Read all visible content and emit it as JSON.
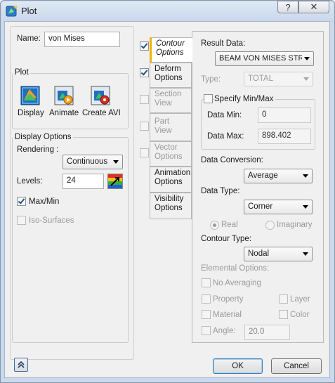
{
  "window": {
    "title": "Plot",
    "help_glyph": "?",
    "close_glyph": "✕"
  },
  "left": {
    "name_label": "Name:",
    "name_value": "von Mises",
    "plot_group": "Plot",
    "display_label": "Display",
    "animate_label": "Animate",
    "avi_label": "Create AVI",
    "display_options_group": "Display Options",
    "rendering_label": "Rendering :",
    "rendering_value": "Continuous",
    "levels_label": "Levels:",
    "levels_value": "24",
    "maxmin_label": "Max/Min",
    "maxmin_checked": true,
    "iso_label": "Iso-Surfaces",
    "iso_checked": false
  },
  "tabs": [
    {
      "line1": "Contour",
      "line2": "Options",
      "checked": true,
      "active": true,
      "disabled": false
    },
    {
      "line1": "Deform",
      "line2": "Options",
      "checked": true,
      "active": false,
      "disabled": false
    },
    {
      "line1": "Section",
      "line2": "View",
      "checked": false,
      "active": false,
      "disabled": true
    },
    {
      "line1": "Part View",
      "line2": "",
      "checked": false,
      "active": false,
      "disabled": true
    },
    {
      "line1": "Vector",
      "line2": "Options",
      "checked": false,
      "active": false,
      "disabled": true
    },
    {
      "line1": "Animation",
      "line2": "Options",
      "active": false,
      "disabled": false
    },
    {
      "line1": "Visibility",
      "line2": "Options",
      "active": false,
      "disabled": false
    }
  ],
  "contour": {
    "result_data_label": "Result Data:",
    "result_data_value": "BEAM VON MISES STRESS",
    "type_label": "Type:",
    "type_value": "TOTAL",
    "specify_minmax_label": "Specify Min/Max",
    "data_min_label": "Data Min:",
    "data_min_value": "0",
    "data_max_label": "Data Max:",
    "data_max_value": "898.402",
    "data_conversion_label": "Data Conversion:",
    "data_conversion_value": "Average",
    "data_type_label": "Data Type:",
    "data_type_value": "Corner",
    "real_label": "Real",
    "imaginary_label": "Imaginary",
    "contour_type_label": "Contour Type:",
    "contour_type_value": "Nodal",
    "elemental_options_label": "Elemental Options:",
    "no_averaging_label": "No Averaging",
    "property_label": "Property",
    "layer_label": "Layer",
    "material_label": "Material",
    "color_label": "Color",
    "angle_label": "Angle:",
    "angle_value": "20.0"
  },
  "footer": {
    "ok_label": "OK",
    "cancel_label": "Cancel",
    "collapse_glyph": "⌃"
  },
  "colors": {
    "tab_accent": "#f0b400",
    "tick": "#1f4f8f"
  }
}
